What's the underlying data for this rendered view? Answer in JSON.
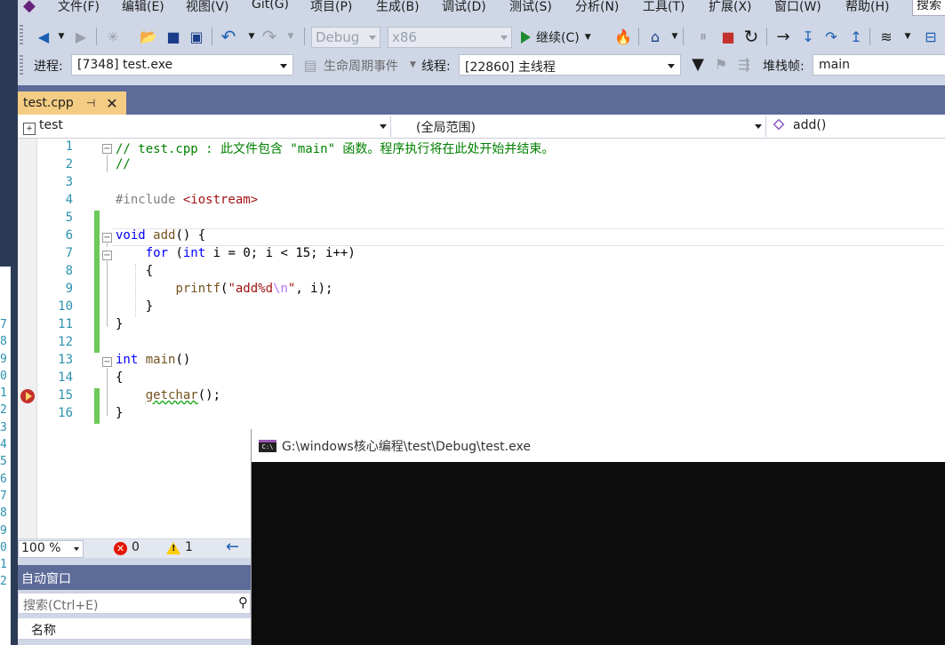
{
  "menubar": {
    "items": [
      "文件(F)",
      "编辑(E)",
      "视图(V)",
      "Git(G)",
      "项目(P)",
      "生成(B)",
      "调试(D)",
      "测试(S)",
      "分析(N)",
      "工具(T)",
      "扩展(X)",
      "窗口(W)",
      "帮助(H)"
    ],
    "search_label": "搜索"
  },
  "toolbar": {
    "config": "Debug",
    "platform": "x86",
    "continue_label": "继续(C)"
  },
  "debug_location": {
    "process_label": "进程:",
    "process_value": "[7348] test.exe",
    "lifecycle_label": "生命周期事件",
    "thread_label": "线程:",
    "thread_value": "[22860] 主线程",
    "stackframe_label": "堆栈帧:",
    "stackframe_value": "main"
  },
  "document_tab": {
    "title": "test.cpp"
  },
  "nav_bar": {
    "project": "test",
    "scope": "(全局范围)",
    "member": "add()"
  },
  "editor": {
    "line_numbers": [
      "1",
      "2",
      "3",
      "4",
      "5",
      "6",
      "7",
      "8",
      "9",
      "10",
      "11",
      "12",
      "13",
      "14",
      "15",
      "16"
    ]
  },
  "left_edge_digits": [
    "7",
    "8",
    "9",
    "0",
    "1",
    "2",
    "3",
    "4",
    "5",
    "6",
    "7",
    "8",
    "9",
    "0",
    "1",
    "2"
  ],
  "statusbar": {
    "zoom": "100 %",
    "errors": "0",
    "warnings": "1"
  },
  "autos": {
    "title": "自动窗口",
    "search_placeholder": "搜索(Ctrl+E)",
    "column_name": "名称"
  },
  "console": {
    "title": "G:\\windows核心编程\\test\\Debug\\test.exe",
    "icon_text": "C:\\"
  },
  "colors": {
    "tab_active": "#f5cc84",
    "panel_header": "#5d6b99",
    "change_bar": "#6dc959",
    "breakpoint": "#c4302b"
  }
}
